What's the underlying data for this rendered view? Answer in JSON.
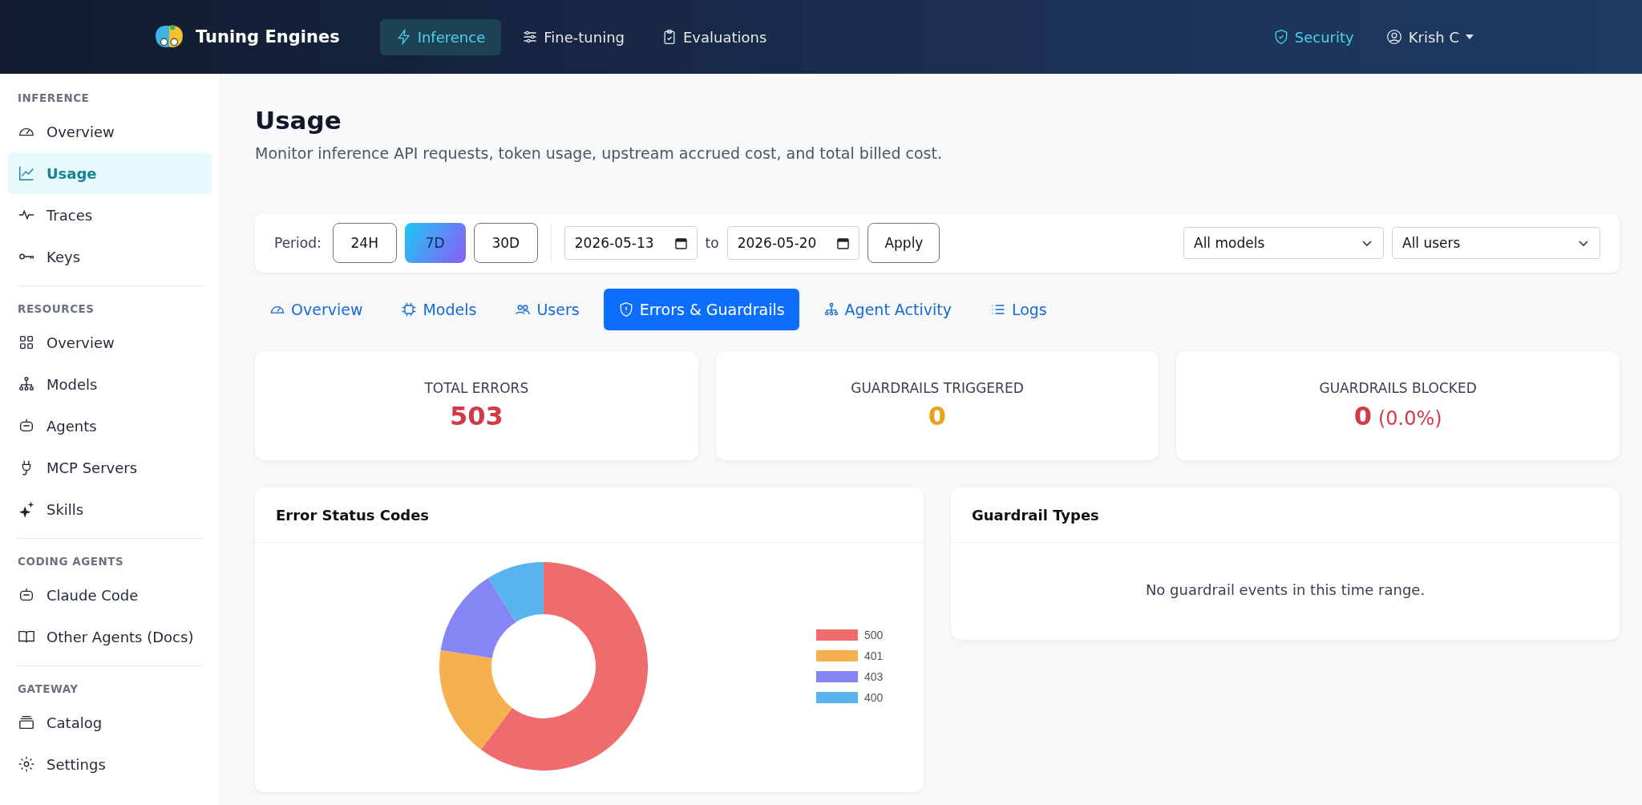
{
  "app": {
    "name": "Tuning Engines"
  },
  "top_nav": [
    {
      "label": "Inference",
      "kind": "bolt",
      "selected": true
    },
    {
      "label": "Fine-tuning",
      "kind": "sliders",
      "selected": false
    },
    {
      "label": "Evaluations",
      "kind": "clipboard",
      "selected": false
    }
  ],
  "security": {
    "label": "Security"
  },
  "user": {
    "name": "Krish C"
  },
  "sidebar": {
    "sections": [
      {
        "title": "INFERENCE",
        "items": [
          {
            "label": "Overview",
            "kind": "gauge",
            "selected": false
          },
          {
            "label": "Usage",
            "kind": "chart",
            "selected": true
          },
          {
            "label": "Traces",
            "kind": "pulse",
            "selected": false
          },
          {
            "label": "Keys",
            "kind": "key",
            "selected": false
          }
        ]
      },
      {
        "title": "RESOURCES",
        "items": [
          {
            "label": "Overview",
            "kind": "grid",
            "selected": false
          },
          {
            "label": "Models",
            "kind": "tree",
            "selected": false
          },
          {
            "label": "Agents",
            "kind": "robot",
            "selected": false
          },
          {
            "label": "MCP Servers",
            "kind": "plug",
            "selected": false
          },
          {
            "label": "Skills",
            "kind": "sparkle",
            "selected": false
          }
        ]
      },
      {
        "title": "CODING AGENTS",
        "items": [
          {
            "label": "Claude Code",
            "kind": "robot",
            "selected": false
          },
          {
            "label": "Other Agents (Docs)",
            "kind": "book",
            "selected": false
          }
        ]
      },
      {
        "title": "GATEWAY",
        "items": [
          {
            "label": "Catalog",
            "kind": "tray",
            "selected": false
          },
          {
            "label": "Settings",
            "kind": "gear",
            "selected": false
          }
        ]
      }
    ]
  },
  "page": {
    "title": "Usage",
    "subtitle": "Monitor inference API requests, token usage, upstream accrued cost, and total billed cost."
  },
  "filters": {
    "period_label": "Period:",
    "periods": [
      {
        "label": "24H",
        "selected": false
      },
      {
        "label": "7D",
        "selected": true
      },
      {
        "label": "30D",
        "selected": false
      }
    ],
    "from": "2026-05-13",
    "to_label": "to",
    "to": "2026-05-20",
    "apply": "Apply",
    "model": "All models",
    "user": "All users"
  },
  "tabs": [
    {
      "label": "Overview",
      "kind": "gauge",
      "selected": false
    },
    {
      "label": "Models",
      "kind": "chip",
      "selected": false
    },
    {
      "label": "Users",
      "kind": "users",
      "selected": false
    },
    {
      "label": "Errors & Guardrails",
      "kind": "shield",
      "selected": true
    },
    {
      "label": "Agent Activity",
      "kind": "tree",
      "selected": false
    },
    {
      "label": "Logs",
      "kind": "list",
      "selected": false
    }
  ],
  "stats": [
    {
      "label": "TOTAL ERRORS",
      "value": "503",
      "color": "#d13b48"
    },
    {
      "label": "GUARDRAILS TRIGGERED",
      "value": "0",
      "color": "#e8a21c"
    },
    {
      "label": "GUARDRAILS BLOCKED",
      "value": "0",
      "extra": "(0.0%)",
      "color": "#d13b48"
    }
  ],
  "error_chart": {
    "title": "Error Status Codes",
    "legend": [
      {
        "label": "500",
        "color": "#f06b6b"
      },
      {
        "label": "401",
        "color": "#f5b14f"
      },
      {
        "label": "403",
        "color": "#8585f5"
      },
      {
        "label": "400",
        "color": "#58b4ec"
      }
    ]
  },
  "guardrail_panel": {
    "title": "Guardrail Types",
    "empty": "No guardrail events in this time range."
  }
}
